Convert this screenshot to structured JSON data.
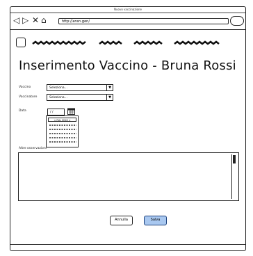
{
  "window": {
    "title": "Nuovo vaccinazione"
  },
  "toolbar": {
    "back_icon": "back-arrow-icon",
    "forward_icon": "forward-arrow-icon",
    "stop_icon": "close-icon",
    "home_icon": "home-icon",
    "url": "http://ansn.gen/"
  },
  "page": {
    "title": "Inserimento Vaccino - Bruna Rossi"
  },
  "form": {
    "vaccino_label": "Vaccino",
    "vaccino_value": "Seleziona...",
    "vaccinatore_label": "Vaccinatore",
    "vaccinatore_value": "Seleziona...",
    "data_label": "Data",
    "data_value": "/ /",
    "calendar_header": "< Feb 2016 >",
    "note_label": "Altre osservazioni"
  },
  "buttons": {
    "cancel": "Annulla",
    "save": "Salva"
  },
  "colors": {
    "save_button": "#a9c8f0",
    "save_border": "#1a3f7a"
  }
}
